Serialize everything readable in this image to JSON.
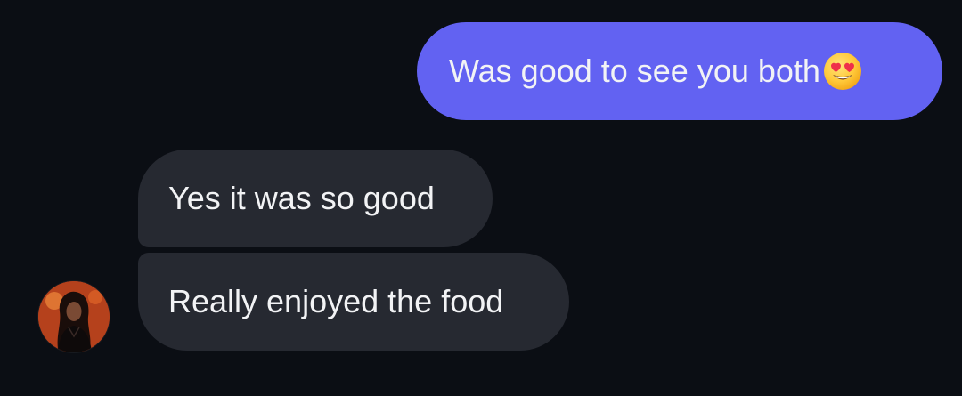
{
  "conversation": {
    "messages": [
      {
        "direction": "sent",
        "text": "Was good to see you both",
        "emoji": "smiling-face-with-heart-eyes-icon"
      },
      {
        "direction": "received",
        "text": "Yes it was so good"
      },
      {
        "direction": "received",
        "text": "Really enjoyed the food"
      }
    ],
    "contact_avatar": "contact-avatar-photo"
  },
  "colors": {
    "background": "#0b0e14",
    "sent_bubble": "#6262f2",
    "received_bubble": "#262931",
    "text": "#f2f3f5"
  }
}
